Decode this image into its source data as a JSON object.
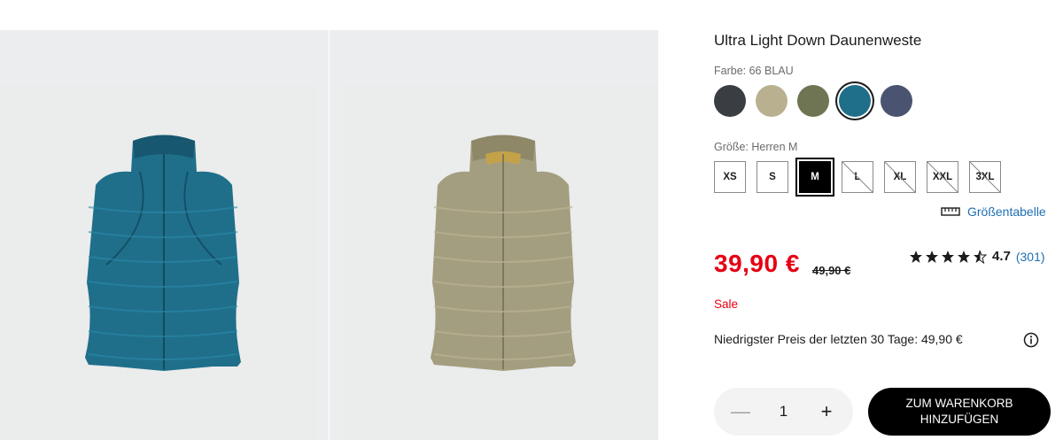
{
  "product": {
    "title": "Ultra Light Down Daunenweste",
    "color_label": "Farbe: 66 BLAU",
    "size_label": "Größe: Herren M"
  },
  "swatches": [
    {
      "name": "dark-gray",
      "color": "#3a3d42"
    },
    {
      "name": "beige",
      "color": "#b9b08f"
    },
    {
      "name": "olive",
      "color": "#6f7452"
    },
    {
      "name": "blue",
      "color": "#1f6f8b",
      "selected": true
    },
    {
      "name": "navy",
      "color": "#4a5470"
    }
  ],
  "sizes": [
    {
      "label": "XS",
      "state": "available"
    },
    {
      "label": "S",
      "state": "available"
    },
    {
      "label": "M",
      "state": "selected"
    },
    {
      "label": "L",
      "state": "unavailable"
    },
    {
      "label": "XL",
      "state": "unavailable"
    },
    {
      "label": "XXL",
      "state": "unavailable"
    },
    {
      "label": "3XL",
      "state": "unavailable"
    }
  ],
  "size_chart": {
    "label": "Größentabelle",
    "icon": "ruler-icon"
  },
  "pricing": {
    "price": "39,90 €",
    "old_price": "49,90 €",
    "sale": "Sale",
    "lowest": "Niedrigster Preis der letzten 30 Tage: 49,90 €"
  },
  "rating": {
    "stars": 4.5,
    "value": "4.7",
    "count": "(301)"
  },
  "quantity": {
    "value": "1",
    "minus": "—",
    "plus": "+"
  },
  "cart": {
    "line1": "ZUM WARENKORB",
    "line2": "HINZUFÜGEN"
  },
  "colors": {
    "accent_red": "#e60012",
    "link_blue": "#1f6fb3"
  },
  "images": [
    {
      "name": "vest-blue-image",
      "fill": "#1f6f8b"
    },
    {
      "name": "vest-beige-image",
      "fill": "#a49e80"
    }
  ]
}
